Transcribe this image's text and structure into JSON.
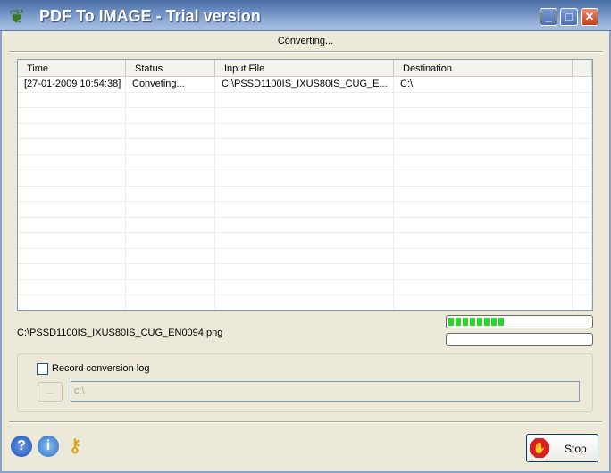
{
  "window": {
    "title": "PDF To IMAGE - Trial version"
  },
  "status_text": "Converting...",
  "table": {
    "columns": [
      "Time",
      "Status",
      "Input File",
      "Destination"
    ],
    "rows": [
      [
        "[27-01-2009 10:54:38]",
        "Conveting...",
        "C:\\PSSD1100IS_IXUS80IS_CUG_E...",
        "C:\\"
      ]
    ]
  },
  "current_file": "C:\\PSSD1100IS_IXUS80IS_CUG_EN0094.png",
  "progress": {
    "file_percent": 40,
    "total_percent": 0
  },
  "log": {
    "checkbox_label": "Record conversion log",
    "checked": false,
    "browse_label": "...",
    "path_value": "c:\\"
  },
  "stop_label": "Stop"
}
